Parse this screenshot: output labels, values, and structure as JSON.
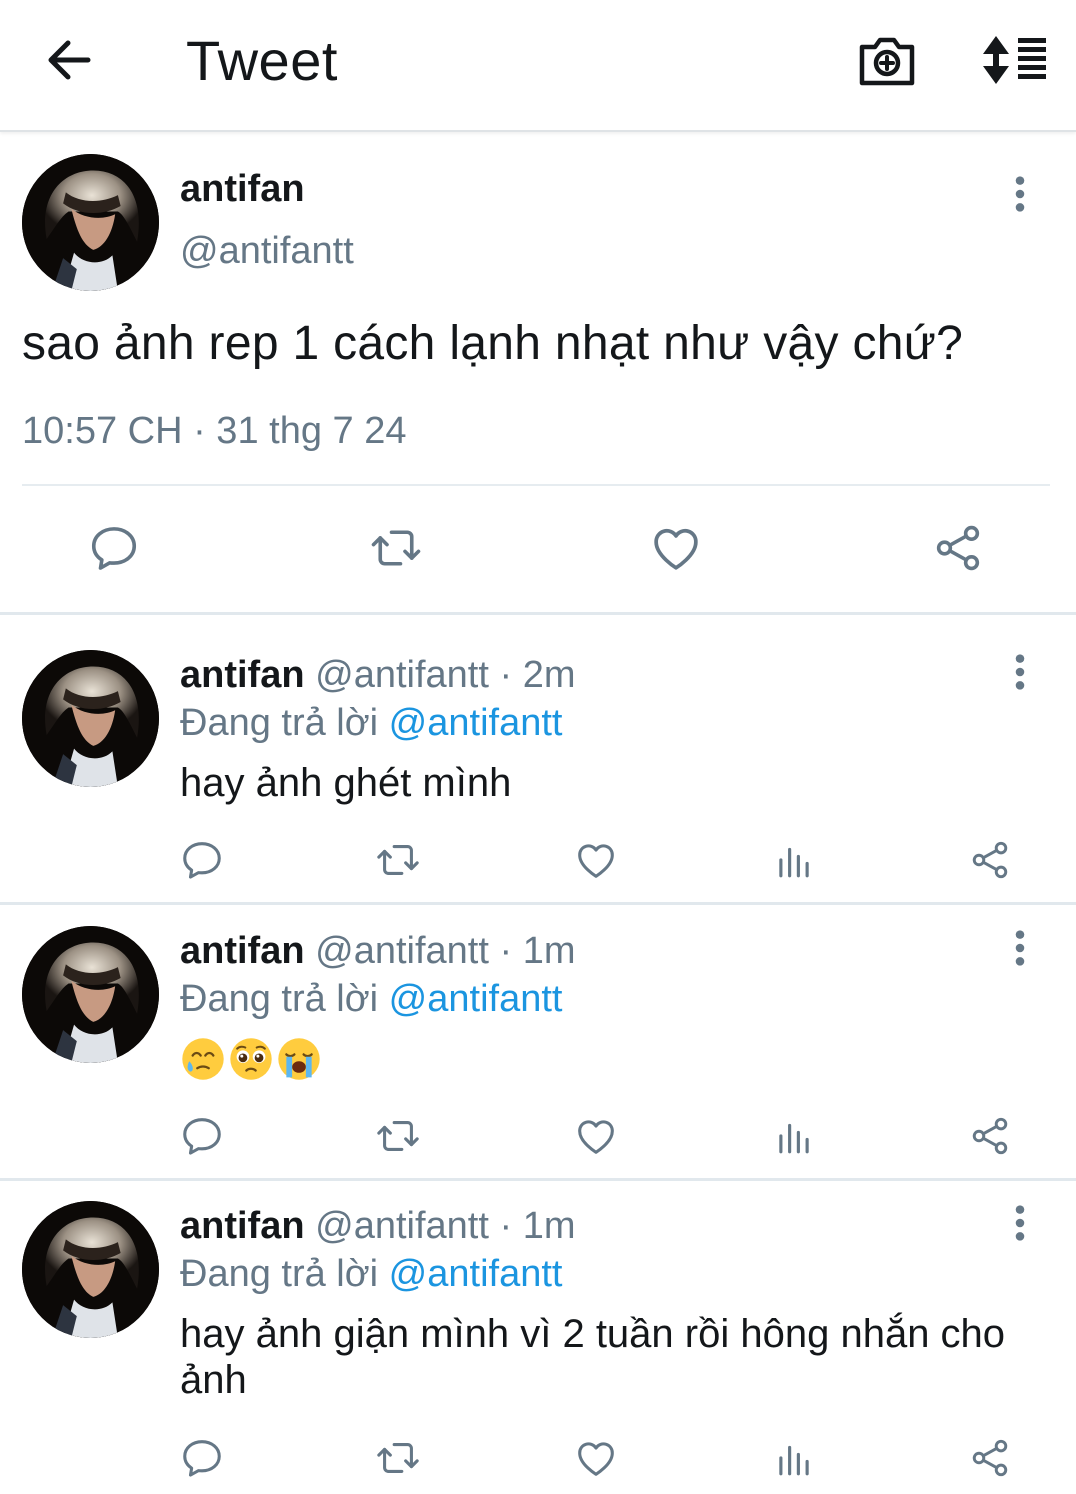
{
  "header": {
    "title": "Tweet",
    "back_icon": "arrow-left-icon",
    "camera_icon": "camera-plus-icon",
    "sort_icon": "sort-list-icon"
  },
  "main_tweet": {
    "name": "antifan",
    "handle": "@antifantt",
    "text": "sao ảnh rep 1 cách lạnh nhạt như vậy chứ?",
    "timestamp": "10:57 CH · 31 thg 7 24",
    "actions": [
      "reply-icon",
      "retweet-icon",
      "like-icon",
      "share-icon"
    ]
  },
  "replies": [
    {
      "name": "antifan",
      "handle": "@antifantt",
      "dot": "·",
      "time": "2m",
      "replying_prefix": "Đang trả lời",
      "replying_to": "@antifantt",
      "text": "hay ảnh ghét mình"
    },
    {
      "name": "antifan",
      "handle": "@antifantt",
      "dot": "·",
      "time": "1m",
      "replying_prefix": "Đang trả lời",
      "replying_to": "@antifantt",
      "emojis": [
        "face-holding-back-tears-icon",
        "pleading-face-icon",
        "loudly-crying-face-icon"
      ]
    },
    {
      "name": "antifan",
      "handle": "@antifantt",
      "dot": "·",
      "time": "1m",
      "replying_prefix": "Đang trả lời",
      "replying_to": "@antifantt",
      "text": "hay ảnh giận mình vì 2 tuần rồi hông nhắn cho ảnh"
    }
  ],
  "colors": {
    "text": "#14171a",
    "secondary": "#657786",
    "accent": "#1b95e0",
    "divider": "#e1e8ed"
  }
}
